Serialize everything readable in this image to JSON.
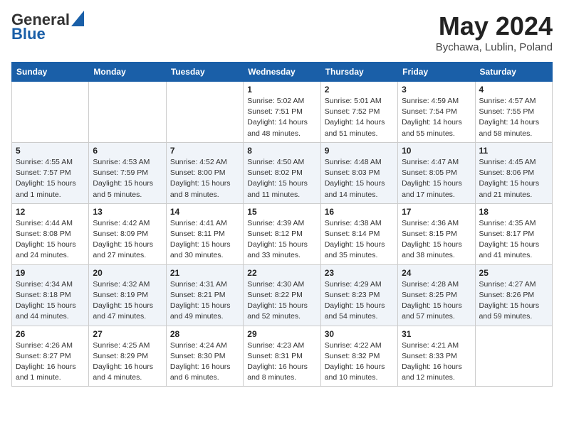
{
  "header": {
    "logo_general": "General",
    "logo_blue": "Blue",
    "month": "May 2024",
    "location": "Bychawa, Lublin, Poland"
  },
  "weekdays": [
    "Sunday",
    "Monday",
    "Tuesday",
    "Wednesday",
    "Thursday",
    "Friday",
    "Saturday"
  ],
  "weeks": [
    [
      {
        "day": "",
        "sunrise": "",
        "sunset": "",
        "daylight": ""
      },
      {
        "day": "",
        "sunrise": "",
        "sunset": "",
        "daylight": ""
      },
      {
        "day": "",
        "sunrise": "",
        "sunset": "",
        "daylight": ""
      },
      {
        "day": "1",
        "sunrise": "Sunrise: 5:02 AM",
        "sunset": "Sunset: 7:51 PM",
        "daylight": "Daylight: 14 hours and 48 minutes."
      },
      {
        "day": "2",
        "sunrise": "Sunrise: 5:01 AM",
        "sunset": "Sunset: 7:52 PM",
        "daylight": "Daylight: 14 hours and 51 minutes."
      },
      {
        "day": "3",
        "sunrise": "Sunrise: 4:59 AM",
        "sunset": "Sunset: 7:54 PM",
        "daylight": "Daylight: 14 hours and 55 minutes."
      },
      {
        "day": "4",
        "sunrise": "Sunrise: 4:57 AM",
        "sunset": "Sunset: 7:55 PM",
        "daylight": "Daylight: 14 hours and 58 minutes."
      }
    ],
    [
      {
        "day": "5",
        "sunrise": "Sunrise: 4:55 AM",
        "sunset": "Sunset: 7:57 PM",
        "daylight": "Daylight: 15 hours and 1 minute."
      },
      {
        "day": "6",
        "sunrise": "Sunrise: 4:53 AM",
        "sunset": "Sunset: 7:59 PM",
        "daylight": "Daylight: 15 hours and 5 minutes."
      },
      {
        "day": "7",
        "sunrise": "Sunrise: 4:52 AM",
        "sunset": "Sunset: 8:00 PM",
        "daylight": "Daylight: 15 hours and 8 minutes."
      },
      {
        "day": "8",
        "sunrise": "Sunrise: 4:50 AM",
        "sunset": "Sunset: 8:02 PM",
        "daylight": "Daylight: 15 hours and 11 minutes."
      },
      {
        "day": "9",
        "sunrise": "Sunrise: 4:48 AM",
        "sunset": "Sunset: 8:03 PM",
        "daylight": "Daylight: 15 hours and 14 minutes."
      },
      {
        "day": "10",
        "sunrise": "Sunrise: 4:47 AM",
        "sunset": "Sunset: 8:05 PM",
        "daylight": "Daylight: 15 hours and 17 minutes."
      },
      {
        "day": "11",
        "sunrise": "Sunrise: 4:45 AM",
        "sunset": "Sunset: 8:06 PM",
        "daylight": "Daylight: 15 hours and 21 minutes."
      }
    ],
    [
      {
        "day": "12",
        "sunrise": "Sunrise: 4:44 AM",
        "sunset": "Sunset: 8:08 PM",
        "daylight": "Daylight: 15 hours and 24 minutes."
      },
      {
        "day": "13",
        "sunrise": "Sunrise: 4:42 AM",
        "sunset": "Sunset: 8:09 PM",
        "daylight": "Daylight: 15 hours and 27 minutes."
      },
      {
        "day": "14",
        "sunrise": "Sunrise: 4:41 AM",
        "sunset": "Sunset: 8:11 PM",
        "daylight": "Daylight: 15 hours and 30 minutes."
      },
      {
        "day": "15",
        "sunrise": "Sunrise: 4:39 AM",
        "sunset": "Sunset: 8:12 PM",
        "daylight": "Daylight: 15 hours and 33 minutes."
      },
      {
        "day": "16",
        "sunrise": "Sunrise: 4:38 AM",
        "sunset": "Sunset: 8:14 PM",
        "daylight": "Daylight: 15 hours and 35 minutes."
      },
      {
        "day": "17",
        "sunrise": "Sunrise: 4:36 AM",
        "sunset": "Sunset: 8:15 PM",
        "daylight": "Daylight: 15 hours and 38 minutes."
      },
      {
        "day": "18",
        "sunrise": "Sunrise: 4:35 AM",
        "sunset": "Sunset: 8:17 PM",
        "daylight": "Daylight: 15 hours and 41 minutes."
      }
    ],
    [
      {
        "day": "19",
        "sunrise": "Sunrise: 4:34 AM",
        "sunset": "Sunset: 8:18 PM",
        "daylight": "Daylight: 15 hours and 44 minutes."
      },
      {
        "day": "20",
        "sunrise": "Sunrise: 4:32 AM",
        "sunset": "Sunset: 8:19 PM",
        "daylight": "Daylight: 15 hours and 47 minutes."
      },
      {
        "day": "21",
        "sunrise": "Sunrise: 4:31 AM",
        "sunset": "Sunset: 8:21 PM",
        "daylight": "Daylight: 15 hours and 49 minutes."
      },
      {
        "day": "22",
        "sunrise": "Sunrise: 4:30 AM",
        "sunset": "Sunset: 8:22 PM",
        "daylight": "Daylight: 15 hours and 52 minutes."
      },
      {
        "day": "23",
        "sunrise": "Sunrise: 4:29 AM",
        "sunset": "Sunset: 8:23 PM",
        "daylight": "Daylight: 15 hours and 54 minutes."
      },
      {
        "day": "24",
        "sunrise": "Sunrise: 4:28 AM",
        "sunset": "Sunset: 8:25 PM",
        "daylight": "Daylight: 15 hours and 57 minutes."
      },
      {
        "day": "25",
        "sunrise": "Sunrise: 4:27 AM",
        "sunset": "Sunset: 8:26 PM",
        "daylight": "Daylight: 15 hours and 59 minutes."
      }
    ],
    [
      {
        "day": "26",
        "sunrise": "Sunrise: 4:26 AM",
        "sunset": "Sunset: 8:27 PM",
        "daylight": "Daylight: 16 hours and 1 minute."
      },
      {
        "day": "27",
        "sunrise": "Sunrise: 4:25 AM",
        "sunset": "Sunset: 8:29 PM",
        "daylight": "Daylight: 16 hours and 4 minutes."
      },
      {
        "day": "28",
        "sunrise": "Sunrise: 4:24 AM",
        "sunset": "Sunset: 8:30 PM",
        "daylight": "Daylight: 16 hours and 6 minutes."
      },
      {
        "day": "29",
        "sunrise": "Sunrise: 4:23 AM",
        "sunset": "Sunset: 8:31 PM",
        "daylight": "Daylight: 16 hours and 8 minutes."
      },
      {
        "day": "30",
        "sunrise": "Sunrise: 4:22 AM",
        "sunset": "Sunset: 8:32 PM",
        "daylight": "Daylight: 16 hours and 10 minutes."
      },
      {
        "day": "31",
        "sunrise": "Sunrise: 4:21 AM",
        "sunset": "Sunset: 8:33 PM",
        "daylight": "Daylight: 16 hours and 12 minutes."
      },
      {
        "day": "",
        "sunrise": "",
        "sunset": "",
        "daylight": ""
      }
    ]
  ]
}
